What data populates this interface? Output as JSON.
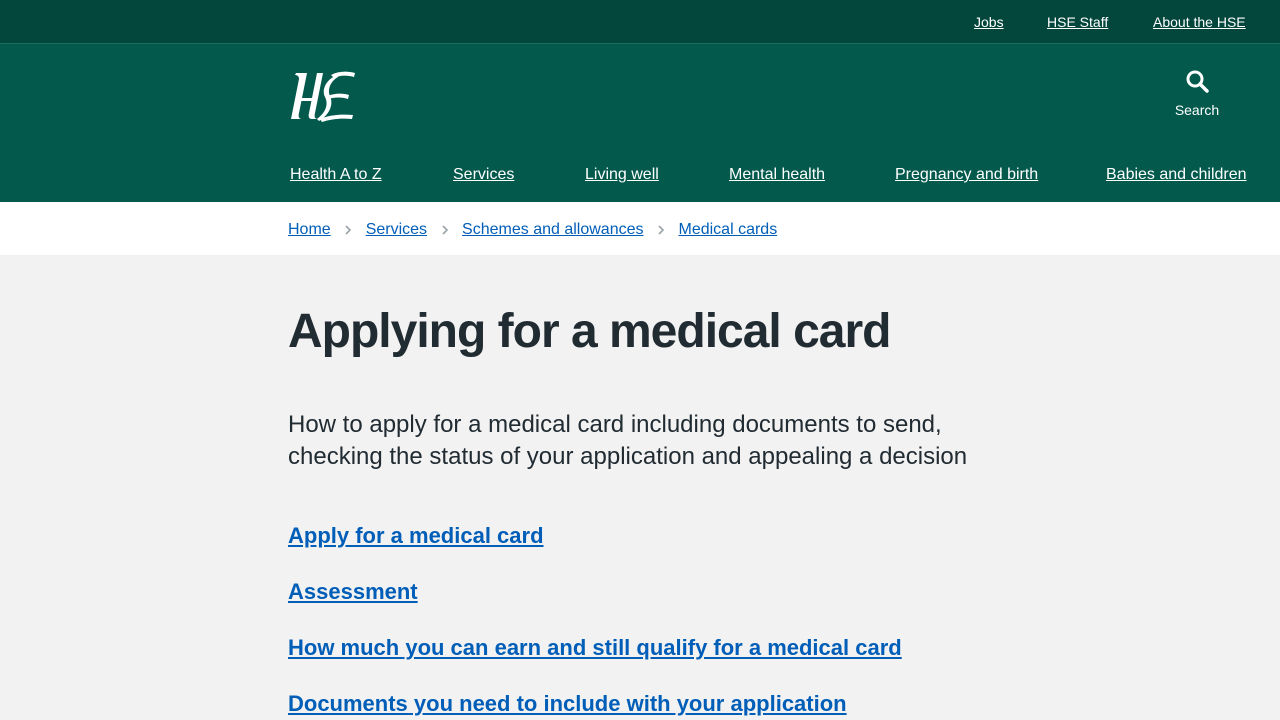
{
  "topbar": {
    "links": [
      "Jobs",
      "HSE Staff",
      "About the HSE"
    ]
  },
  "header": {
    "logo_text": "HSE",
    "search_label": "Search",
    "nav": [
      "Health A to Z",
      "Services",
      "Living well",
      "Mental health",
      "Pregnancy and birth",
      "Babies and children"
    ]
  },
  "breadcrumb": [
    "Home",
    "Services",
    "Schemes and allowances",
    "Medical cards"
  ],
  "main": {
    "title": "Applying for a medical card",
    "lead": "How to apply for a medical card including documents to send, checking the status of your application and appealing a decision",
    "links": [
      "Apply for a medical card",
      "Assessment",
      "How much you can earn and still qualify for a medical card",
      "Documents you need to include with your application"
    ]
  },
  "colors": {
    "topbar": "#02463c",
    "header": "#02594c",
    "link": "#005eb8",
    "page_bg": "#f2f2f2"
  },
  "icons": [
    "hse-logo",
    "search-icon",
    "chevron-right-icon"
  ]
}
